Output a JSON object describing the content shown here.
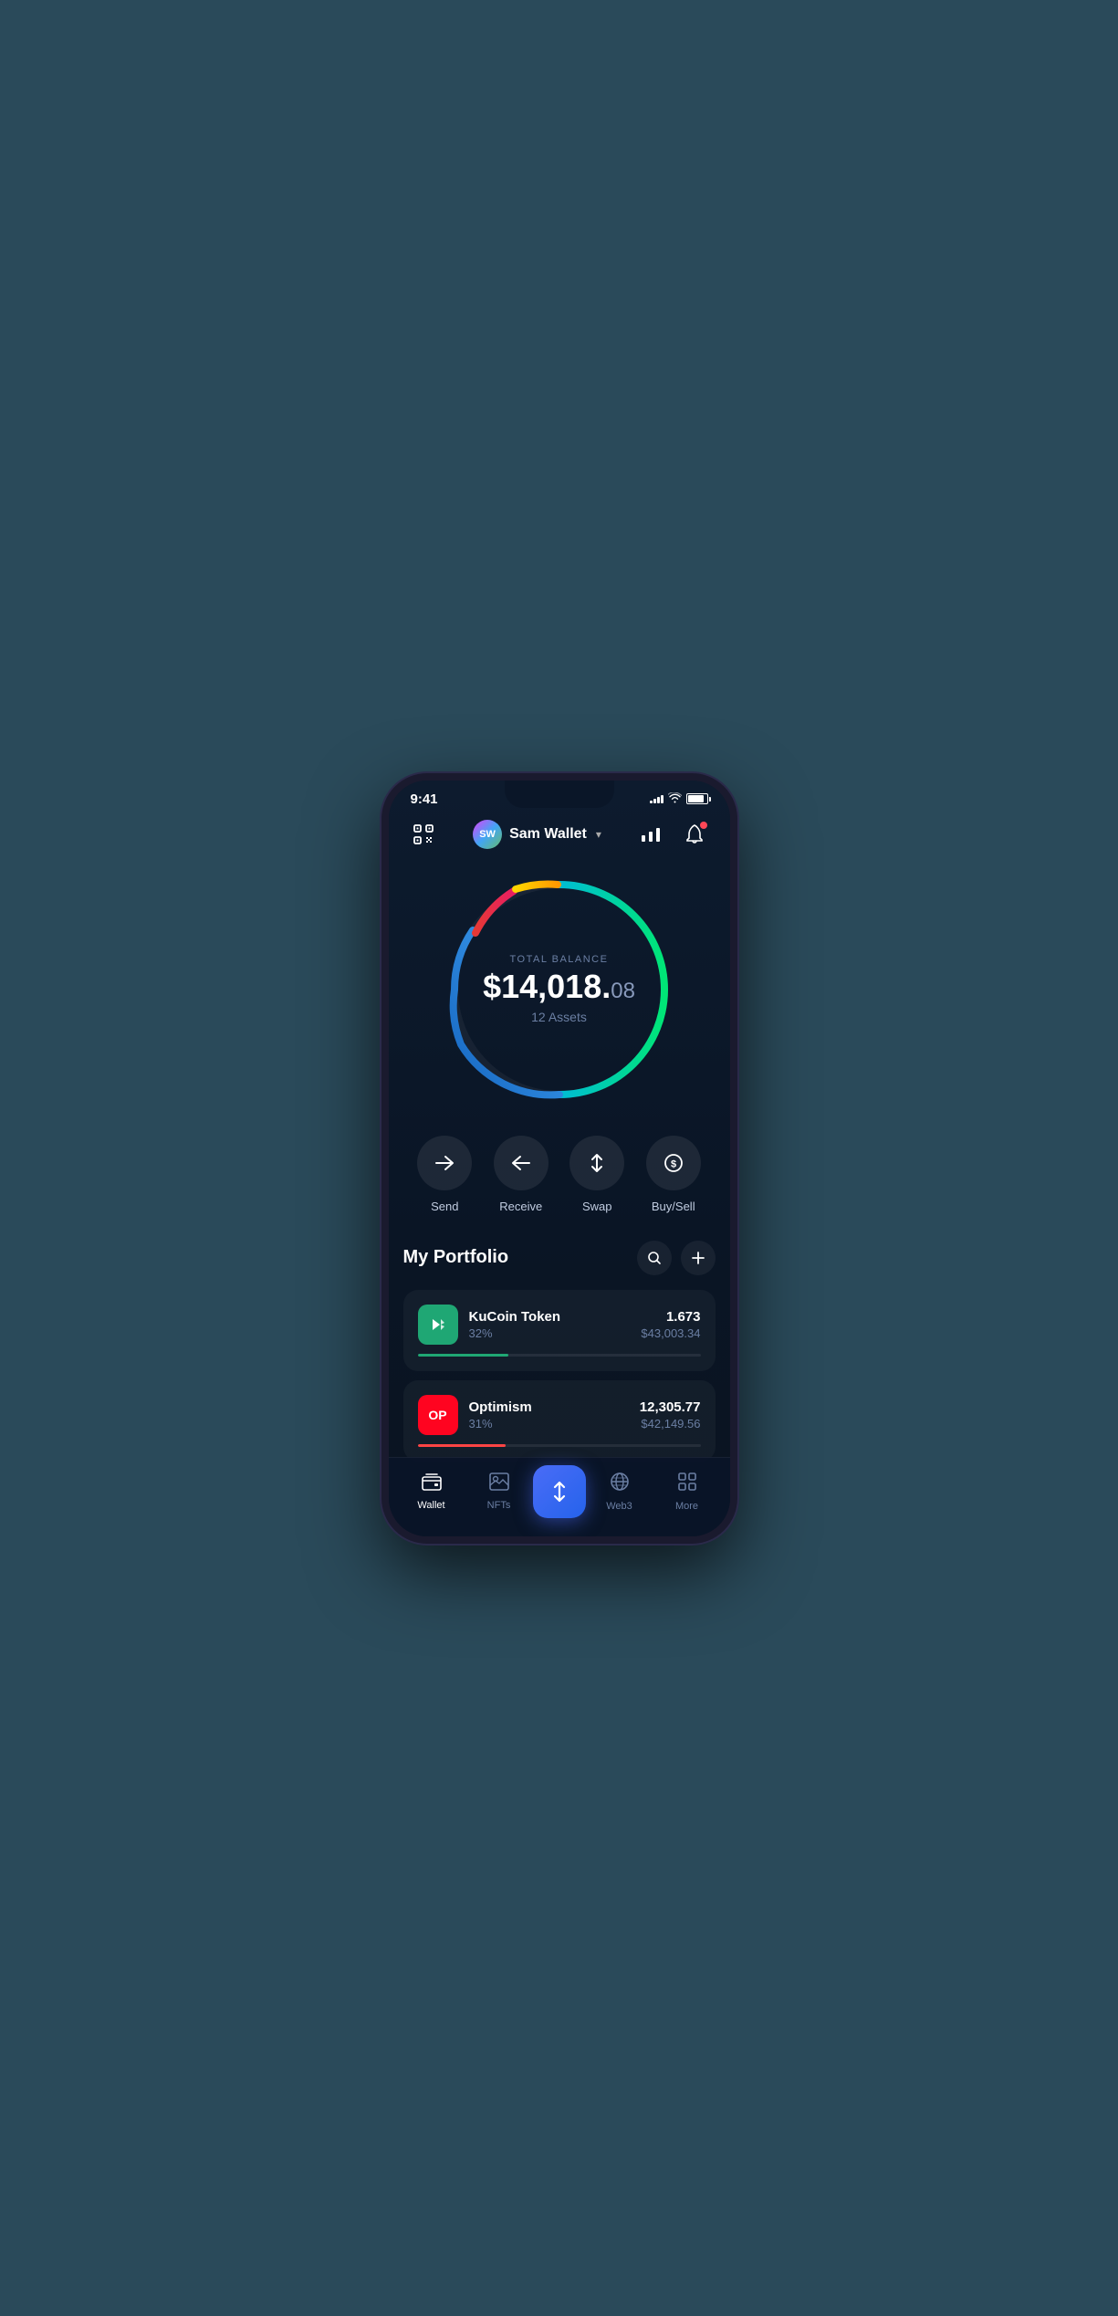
{
  "statusBar": {
    "time": "9:41",
    "signalBars": [
      3,
      5,
      7,
      9
    ],
    "wifi": true,
    "battery": 85
  },
  "header": {
    "scanLabel": "scan",
    "walletName": "Sam Wallet",
    "avatarText": "SW",
    "chartLabel": "chart",
    "bellLabel": "notifications",
    "dropdownLabel": "dropdown"
  },
  "balance": {
    "totalBalanceLabel": "TOTAL BALANCE",
    "balanceWhole": "$14,018.",
    "balanceCents": "08",
    "assetsLabel": "12 Assets"
  },
  "actions": [
    {
      "id": "send",
      "label": "Send",
      "icon": "→"
    },
    {
      "id": "receive",
      "label": "Receive",
      "icon": "←"
    },
    {
      "id": "swap",
      "label": "Swap",
      "icon": "⇅"
    },
    {
      "id": "buysell",
      "label": "Buy/Sell",
      "icon": "$"
    }
  ],
  "portfolio": {
    "title": "My Portfolio",
    "searchLabel": "search",
    "addLabel": "add",
    "assets": [
      {
        "id": "kucoin",
        "name": "KuCoin Token",
        "percentage": "32%",
        "quantity": "1.673",
        "usdValue": "$43,003.34",
        "logoText": "KCS",
        "logoColor": "#1fa774",
        "progressWidth": "32",
        "progressColor": "#1fa774"
      },
      {
        "id": "optimism",
        "name": "Optimism",
        "percentage": "31%",
        "quantity": "12,305.77",
        "usdValue": "$42,149.56",
        "logoText": "OP",
        "logoColor": "#ff0420",
        "progressWidth": "31",
        "progressColor": "#ff4444"
      }
    ]
  },
  "bottomNav": [
    {
      "id": "wallet",
      "label": "Wallet",
      "icon": "💳",
      "active": true
    },
    {
      "id": "nfts",
      "label": "NFTs",
      "icon": "🖼",
      "active": false
    },
    {
      "id": "swap-center",
      "label": "",
      "icon": "⇅",
      "active": false,
      "center": true
    },
    {
      "id": "web3",
      "label": "Web3",
      "icon": "🌐",
      "active": false
    },
    {
      "id": "more",
      "label": "More",
      "icon": "⊞",
      "active": false
    }
  ]
}
